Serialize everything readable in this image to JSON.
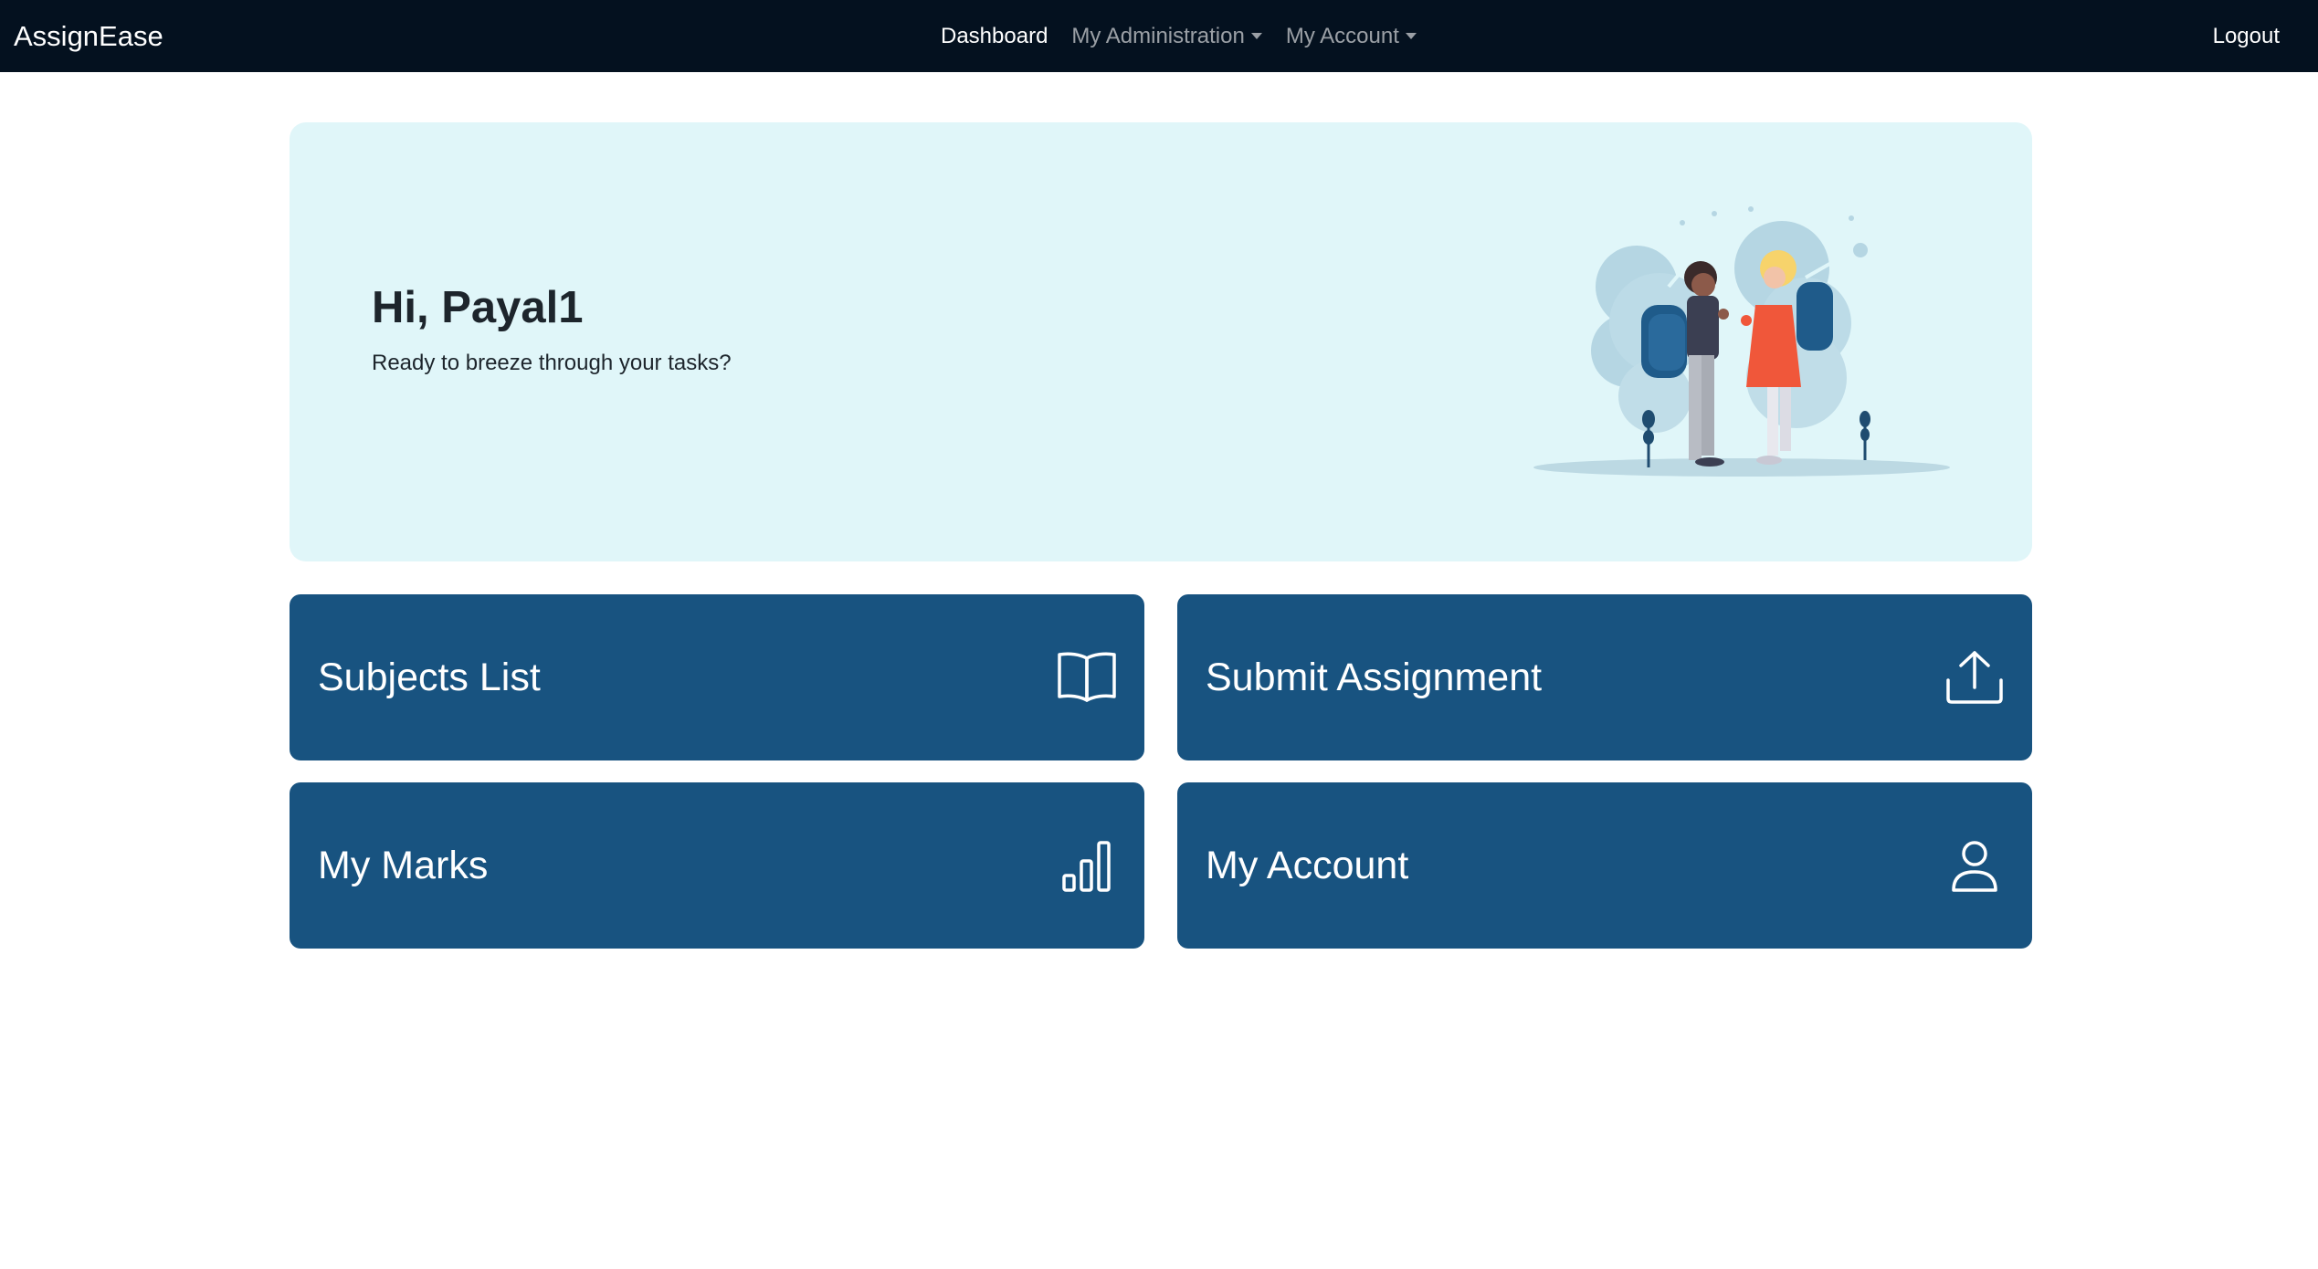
{
  "navbar": {
    "brand": "AssignEase",
    "links": [
      {
        "label": "Dashboard",
        "active": true
      },
      {
        "label": "My Administration",
        "dropdown": true
      },
      {
        "label": "My Account",
        "dropdown": true
      }
    ],
    "logout": "Logout",
    "background_color": "#04111f"
  },
  "hero": {
    "greeting": "Hi, Payal1",
    "subtitle": "Ready to breeze through your tasks?",
    "background_color": "#e0f6f9"
  },
  "cards": [
    {
      "label": "Subjects List",
      "icon": "book-icon"
    },
    {
      "label": "Submit Assignment",
      "icon": "upload-icon"
    },
    {
      "label": "My Marks",
      "icon": "bar-chart-icon"
    },
    {
      "label": "My Account",
      "icon": "person-icon"
    }
  ],
  "colors": {
    "card": "#185380",
    "accent_text": "#ffffff"
  }
}
